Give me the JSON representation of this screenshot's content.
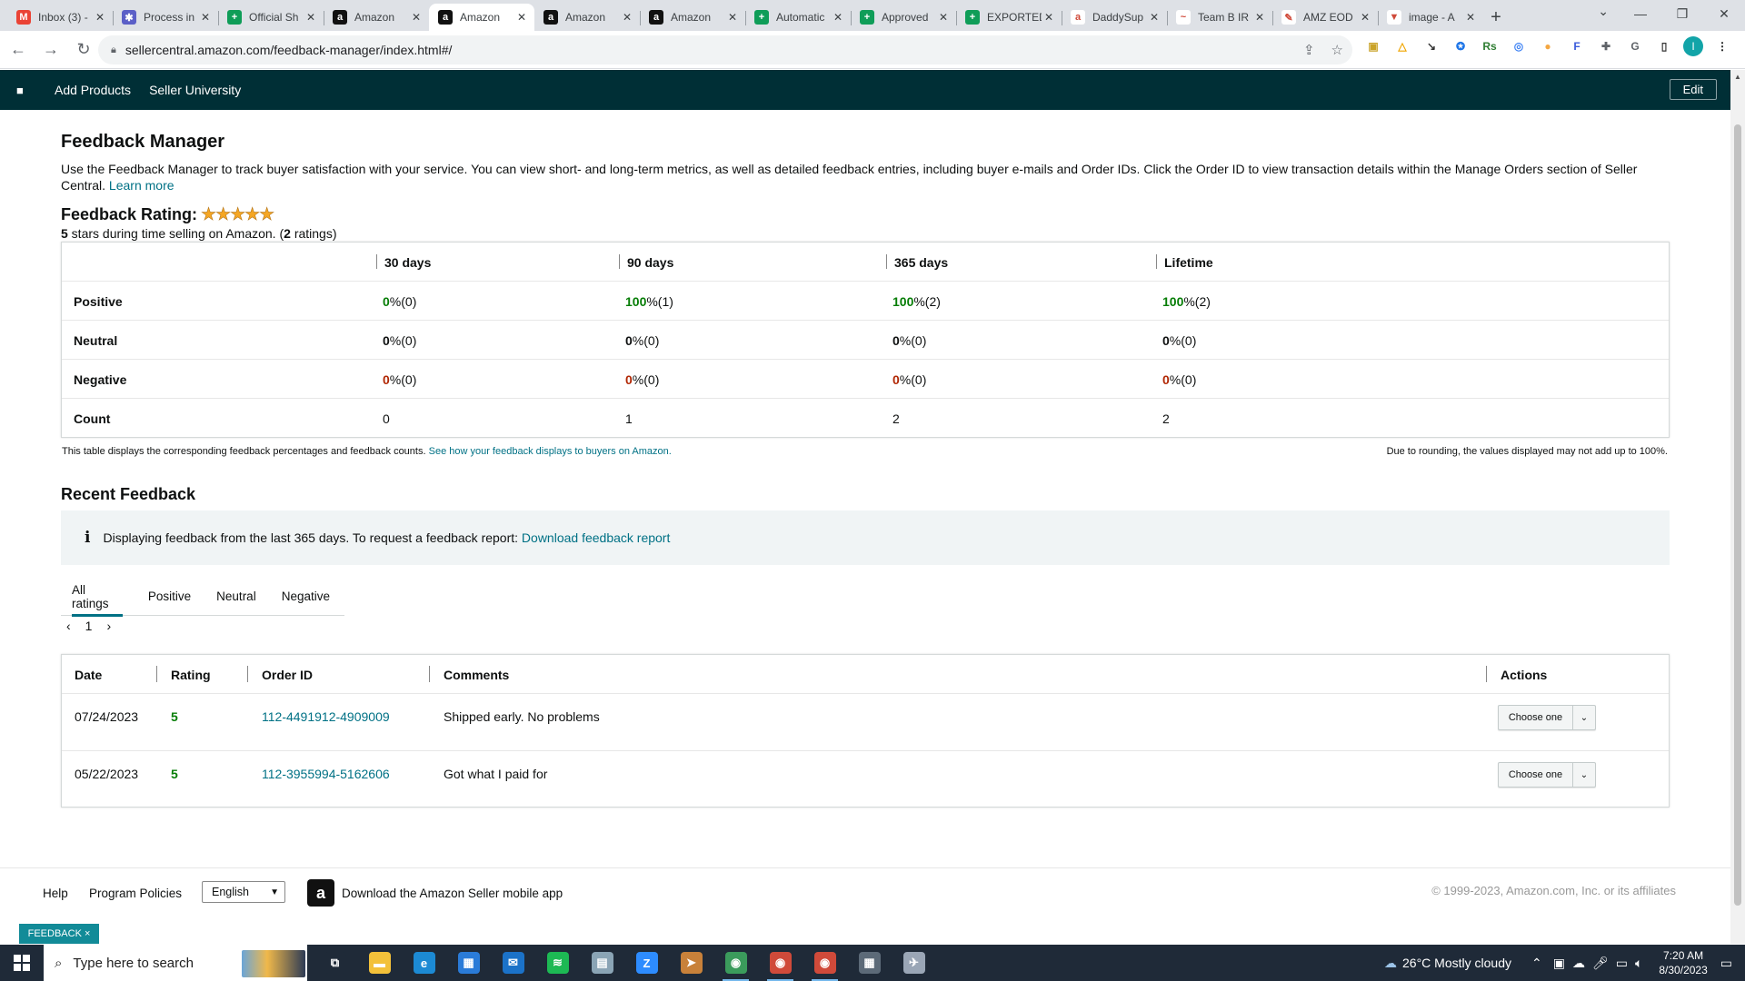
{
  "browser": {
    "tabs": [
      {
        "title": "Inbox (3) -",
        "icon": "gmail-icon",
        "color": "#ea4335",
        "glyph": "M",
        "active": false
      },
      {
        "title": "Process in",
        "icon": "gear-flower-icon",
        "color": "#5b5fc7",
        "glyph": "✱",
        "active": false
      },
      {
        "title": "Official Sh",
        "icon": "sheets-icon",
        "color": "#0f9d58",
        "glyph": "+",
        "active": false
      },
      {
        "title": "Amazon",
        "icon": "amazon-icon",
        "color": "#111111",
        "glyph": "a",
        "active": false
      },
      {
        "title": "Amazon",
        "icon": "amazon-icon",
        "color": "#111111",
        "glyph": "a",
        "active": true
      },
      {
        "title": "Amazon",
        "icon": "amazon-icon",
        "color": "#111111",
        "glyph": "a",
        "active": false
      },
      {
        "title": "Amazon",
        "icon": "amazon-icon",
        "color": "#111111",
        "glyph": "a",
        "active": false
      },
      {
        "title": "Automatic",
        "icon": "sheets-icon",
        "color": "#0f9d58",
        "glyph": "+",
        "active": false
      },
      {
        "title": "Approved",
        "icon": "sheets-icon",
        "color": "#0f9d58",
        "glyph": "+",
        "active": false
      },
      {
        "title": "EXPORTED",
        "icon": "sheets-icon",
        "color": "#0f9d58",
        "glyph": "+",
        "active": false
      },
      {
        "title": "DaddySup",
        "icon": "amazon-small-icon",
        "color": "#ffffff",
        "glyph": "a",
        "active": false
      },
      {
        "title": "Team B IR",
        "icon": "signature-icon",
        "color": "#ffffff",
        "glyph": "~",
        "active": false
      },
      {
        "title": "AMZ EOD",
        "icon": "pen-icon",
        "color": "#ffffff",
        "glyph": "✎",
        "active": false
      },
      {
        "title": "image - A",
        "icon": "triangle-icon",
        "color": "#ffffff",
        "glyph": "▼",
        "active": false
      }
    ],
    "url": "sellercentral.amazon.com/feedback-manager/index.html#/",
    "profile_initial": "I",
    "extensions": [
      "lock-box-icon",
      "chart-icon",
      "cursor-icon",
      "compass-icon",
      "rs-icon",
      "circles-icon",
      "orange-dot-icon",
      "f-icon",
      "puzzle-icon",
      "g-icon",
      "sidebar-icon"
    ]
  },
  "nav": {
    "links": [
      "Add Products",
      "Seller University"
    ],
    "edit_label": "Edit"
  },
  "page": {
    "title": "Feedback Manager",
    "intro": "Use the Feedback Manager to track buyer satisfaction with your service. You can view short- and long-term metrics, as well as detailed feedback entries, including buyer e-mails and Order IDs. Click the Order ID to view transaction details within the Manage Orders section of Seller Central.",
    "learn_more": "Learn more",
    "rating_label": "Feedback Rating:",
    "stars": "★★★★★",
    "rating_stars_value": "5",
    "rating_sub_mid": " stars during time selling on Amazon. (",
    "rating_count": "2",
    "rating_sub_end": " ratings)"
  },
  "stats": {
    "columns": [
      "30 days",
      "90 days",
      "365 days",
      "Lifetime"
    ],
    "rows": [
      {
        "label": "Positive",
        "values": [
          [
            "0",
            " %(0)"
          ],
          [
            "100",
            " %(1)"
          ],
          [
            "100",
            " %(2)"
          ],
          [
            "100",
            " %(2)"
          ]
        ],
        "tone": "green"
      },
      {
        "label": "Neutral",
        "values": [
          [
            "0",
            " %(0)"
          ],
          [
            "0",
            " %(0)"
          ],
          [
            "0",
            " %(0)"
          ],
          [
            "0",
            " %(0)"
          ]
        ],
        "tone": "plain"
      },
      {
        "label": "Negative",
        "values": [
          [
            "0",
            " %(0)"
          ],
          [
            "0",
            " %(0)"
          ],
          [
            "0",
            " %(0)"
          ],
          [
            "0",
            " %(0)"
          ]
        ],
        "tone": "red"
      },
      {
        "label": "Count",
        "values": [
          [
            "0",
            ""
          ],
          [
            "1",
            ""
          ],
          [
            "2",
            ""
          ],
          [
            "2",
            ""
          ]
        ],
        "tone": "plain"
      }
    ],
    "footnote": "This table displays the corresponding feedback percentages and feedback counts.",
    "footnote_link": "See how your feedback displays to buyers on Amazon.",
    "footnote_right": "Due to rounding, the values displayed may not add up to 100%."
  },
  "recent": {
    "title": "Recent Feedback",
    "info_text": "Displaying feedback from the last 365 days. To request a feedback report:",
    "info_link": "Download feedback report",
    "filter_tabs": [
      "All ratings",
      "Positive",
      "Neutral",
      "Negative"
    ],
    "active_tab": 0,
    "page": "1",
    "columns": [
      "Date",
      "Rating",
      "Order ID",
      "Comments",
      "Actions"
    ],
    "rows": [
      {
        "date": "07/24/2023",
        "rating": "5",
        "order_id": "112-4491912-4909009",
        "comment": "Shipped early. No problems",
        "action": "Choose one"
      },
      {
        "date": "05/22/2023",
        "rating": "5",
        "order_id": "112-3955994-5162606",
        "comment": "Got what I paid for",
        "action": "Choose one"
      }
    ]
  },
  "footer": {
    "help": "Help",
    "policies": "Program Policies",
    "language": "English",
    "app_text": "Download the Amazon Seller mobile app",
    "copyright": "© 1999-2023, Amazon.com, Inc. or its affiliates",
    "feedback_tag": "FEEDBACK ×"
  },
  "taskbar": {
    "search_placeholder": "Type here to search",
    "apps": [
      {
        "icon": "task-view-icon",
        "color": "#1f2a38",
        "glyph": "⧉",
        "open": false
      },
      {
        "icon": "file-explorer-icon",
        "color": "#f3c13a",
        "glyph": "▬",
        "open": false
      },
      {
        "icon": "edge-icon",
        "color": "#1c8ad4",
        "glyph": "e",
        "open": false
      },
      {
        "icon": "store-icon",
        "color": "#2a7bd8",
        "glyph": "▦",
        "open": false
      },
      {
        "icon": "mail-icon",
        "color": "#1b72c8",
        "glyph": "✉",
        "open": false
      },
      {
        "icon": "spotify-icon",
        "color": "#1db954",
        "glyph": "≋",
        "open": false
      },
      {
        "icon": "notes-icon",
        "color": "#8aa4b5",
        "glyph": "▤",
        "open": false
      },
      {
        "icon": "zoom-icon",
        "color": "#2d8cff",
        "glyph": "Z",
        "open": false
      },
      {
        "icon": "telegram-icon",
        "color": "#c8813a",
        "glyph": "➤",
        "open": false
      },
      {
        "icon": "chrome-icon",
        "color": "#3b9b5c",
        "glyph": "◉",
        "open": true
      },
      {
        "icon": "chrome-icon",
        "color": "#d04a3a",
        "glyph": "◉",
        "open": true
      },
      {
        "icon": "chrome-icon",
        "color": "#d04a3a",
        "glyph": "◉",
        "open": true
      },
      {
        "icon": "calculator-icon",
        "color": "#5c6a78",
        "glyph": "▦",
        "open": false
      },
      {
        "icon": "paint-icon",
        "color": "#9aa6b6",
        "glyph": "✈",
        "open": false
      }
    ],
    "weather": "26°C  Mostly cloudy",
    "time": "7:20 AM",
    "date": "8/30/2023"
  },
  "colors": {
    "nav_bg": "#002f36",
    "link": "#007185",
    "positive": "#067d06",
    "negative": "#b12704",
    "feedback_tag": "#128b98"
  }
}
